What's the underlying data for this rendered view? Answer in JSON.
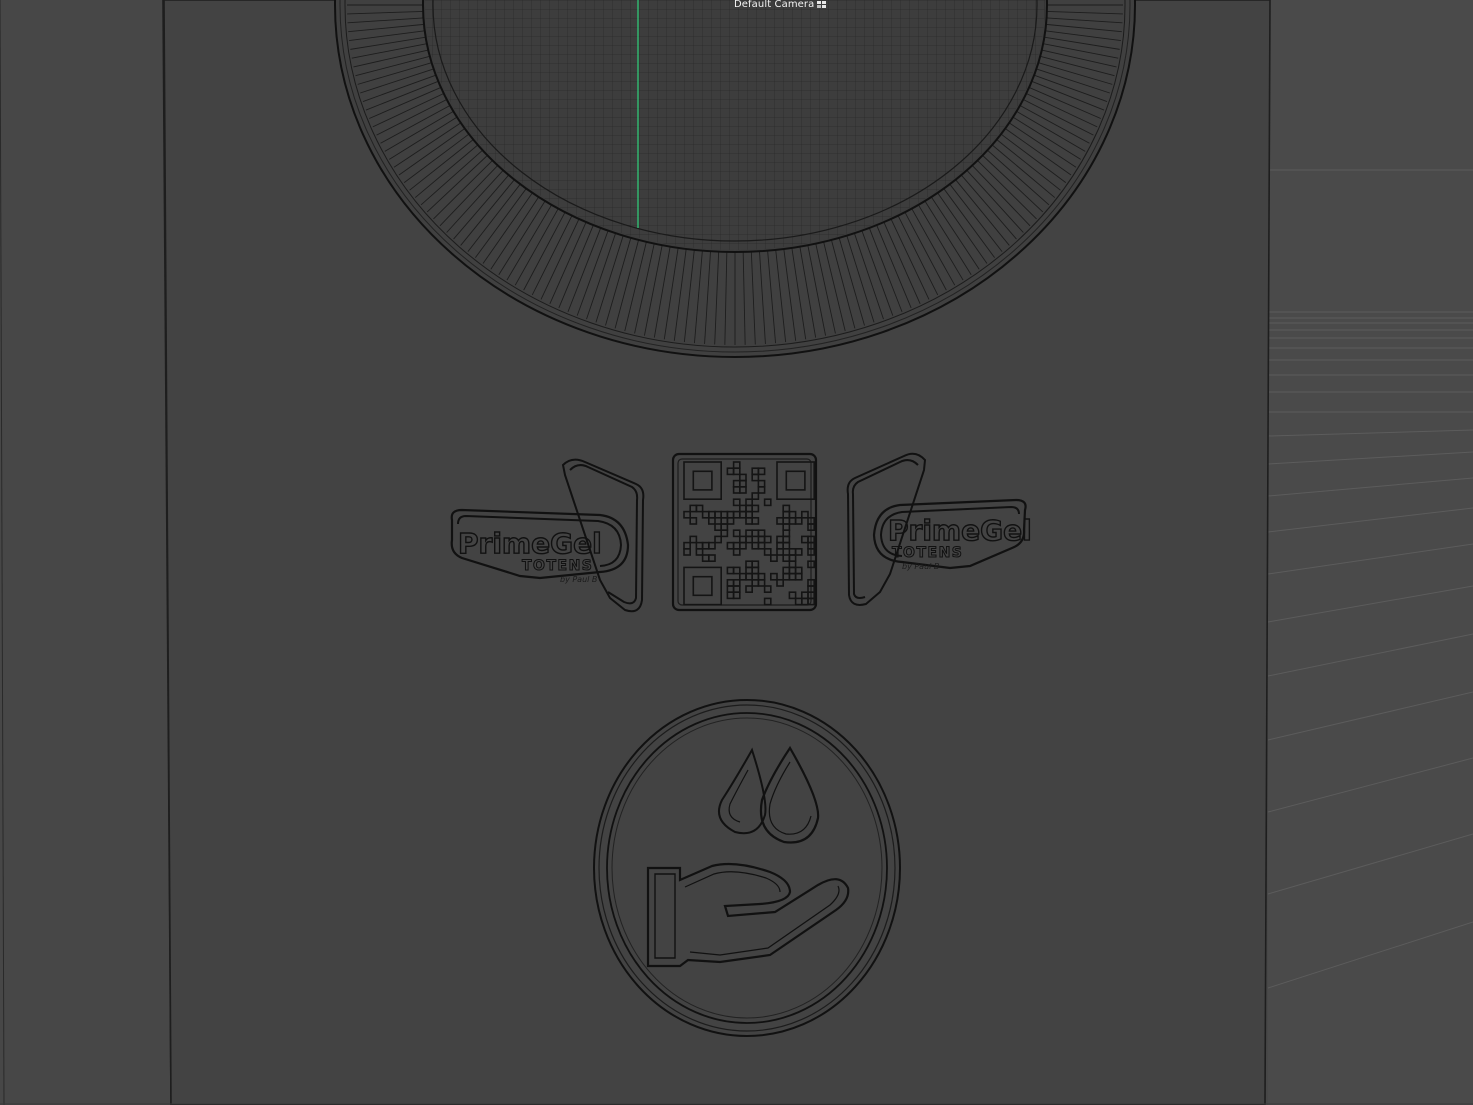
{
  "viewport": {
    "camera_label": "Default Camera",
    "camera_icon": "camera-icon",
    "colors": {
      "background": "#474747",
      "panel": "#424242",
      "wire": "#1a1a1a",
      "axis_green": "#2fd07a",
      "floor_grid": "#5d5d5d"
    }
  },
  "model": {
    "logo_left": {
      "title": "PrimeGel",
      "subtitle": "TOTENS",
      "byline": "by Paul B"
    },
    "logo_right": {
      "title": "PrimeGel",
      "subtitle": "TOTENS",
      "byline": "by Paul B"
    },
    "qr_code_icon": "qr-code-icon",
    "hand_drops_icon": "hand-sanitizer-icon"
  }
}
